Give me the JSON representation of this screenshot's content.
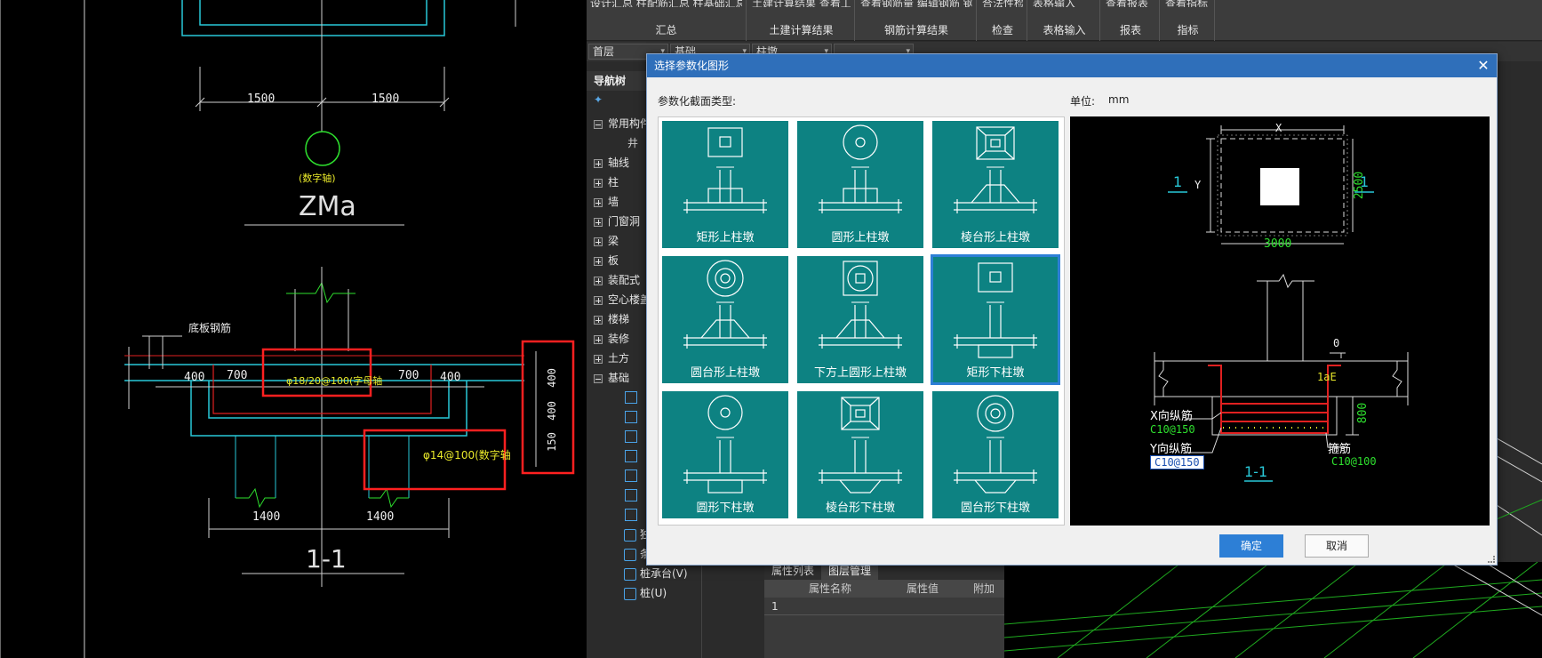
{
  "cad": {
    "top_dims": [
      "1500",
      "1500"
    ],
    "axis_note": "(数字轴)",
    "title_zma": "ZMa",
    "base_rebar_label": "底板钢筋",
    "mid_dims": [
      "400",
      "700",
      "700",
      "400"
    ],
    "rebar1": "φ18/20@100(字母轴",
    "rebar2": "φ14@100(数字轴",
    "vert_dims": [
      "400",
      "400",
      "150"
    ],
    "bottom_dims": [
      "1400",
      "1400"
    ],
    "section_title": "1-1"
  },
  "ribbon": {
    "groups": [
      {
        "top": "设计汇总 柱配筋汇总 柱基础汇总",
        "label": "汇总"
      },
      {
        "top": "土建计算结果 查看工程量",
        "label": "土建计算结果"
      },
      {
        "top": "查看钢筋量 编辑钢筋 钢筋三维",
        "label": "钢筋计算结果"
      },
      {
        "top": "合法性检查",
        "label": "检查"
      },
      {
        "top": "表格输入",
        "label": "表格输入"
      },
      {
        "top": "查看报表",
        "label": "报表"
      },
      {
        "top": "查看指标",
        "label": "指标"
      }
    ]
  },
  "selectors": [
    "首层",
    "基础",
    "柱墩",
    ""
  ],
  "nav": {
    "title": "导航树",
    "items": [
      {
        "label": "常用构件",
        "expanded": true
      },
      {
        "label": "轴线",
        "expanded": false
      },
      {
        "label": "柱",
        "expanded": false
      },
      {
        "label": "墙",
        "expanded": false
      },
      {
        "label": "门窗洞",
        "expanded": false
      },
      {
        "label": "梁",
        "expanded": false
      },
      {
        "label": "板",
        "expanded": false
      },
      {
        "label": "装配式",
        "expanded": false
      },
      {
        "label": "空心楼盖",
        "expanded": false
      },
      {
        "label": "楼梯",
        "expanded": false
      },
      {
        "label": "装修",
        "expanded": false
      },
      {
        "label": "土方",
        "expanded": false
      },
      {
        "label": "基础",
        "expanded": true
      }
    ],
    "sub_items": [
      "独立基础(D)",
      "条形基础(T)",
      "桩承台(V)",
      "桩(U)"
    ]
  },
  "props": {
    "tabs": [
      "属性列表",
      "图层管理"
    ],
    "columns": [
      "属性名称",
      "属性值",
      "附加"
    ],
    "row_num": "1"
  },
  "dialog": {
    "title": "选择参数化图形",
    "type_label": "参数化截面类型:",
    "unit_label": "单位:",
    "unit_value": "mm",
    "shapes": [
      {
        "label": "矩形上柱墩",
        "kind": "rect-up"
      },
      {
        "label": "圆形上柱墩",
        "kind": "circ-up"
      },
      {
        "label": "棱台形上柱墩",
        "kind": "frustum-up"
      },
      {
        "label": "圆台形上柱墩",
        "kind": "cone-up"
      },
      {
        "label": "下方上圆形上柱墩",
        "kind": "squarecirc-up"
      },
      {
        "label": "矩形下柱墩",
        "kind": "rect-down"
      },
      {
        "label": "圆形下柱墩",
        "kind": "circ-down"
      },
      {
        "label": "棱台形下柱墩",
        "kind": "frustum-down"
      },
      {
        "label": "圆台形下柱墩",
        "kind": "cone-down"
      }
    ],
    "selected_index": 5,
    "preview": {
      "dim_x": "X",
      "dim_y": "Y",
      "dim_3000": "3000",
      "dim_2500": "2500",
      "sec_mark": "1",
      "dim_0": "0",
      "dim_lae": "1aE",
      "dim_800": "800",
      "x_rebar_label": "X向纵筋",
      "x_rebar_value": "C10@150",
      "y_rebar_label": "Y向纵筋",
      "y_rebar_value": "C10@150",
      "stirrup_label": "箍筋",
      "stirrup_value": "C10@100",
      "section_title": "1-1"
    },
    "ok": "确定",
    "cancel": "取消"
  }
}
